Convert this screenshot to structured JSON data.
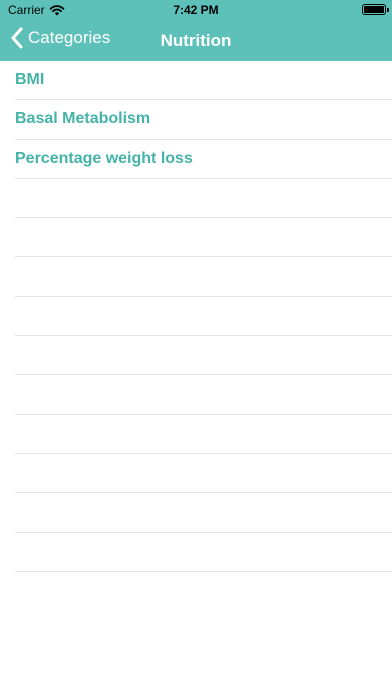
{
  "status_bar": {
    "carrier": "Carrier",
    "time": "7:42 PM",
    "battery_level": 1.0
  },
  "nav": {
    "back_label": "Categories",
    "title": "Nutrition"
  },
  "items": [
    {
      "label": "BMI"
    },
    {
      "label": "Basal Metabolism"
    },
    {
      "label": "Percentage weight loss"
    },
    {
      "label": ""
    },
    {
      "label": ""
    },
    {
      "label": ""
    },
    {
      "label": ""
    },
    {
      "label": ""
    },
    {
      "label": ""
    },
    {
      "label": ""
    },
    {
      "label": ""
    },
    {
      "label": ""
    },
    {
      "label": ""
    }
  ],
  "colors": {
    "header_bg": "#5dc1b9",
    "item_text": "#45b3a9",
    "separator": "#e3e3e3"
  },
  "icons": [
    "wifi-icon",
    "battery-icon",
    "chevron-left-icon"
  ]
}
